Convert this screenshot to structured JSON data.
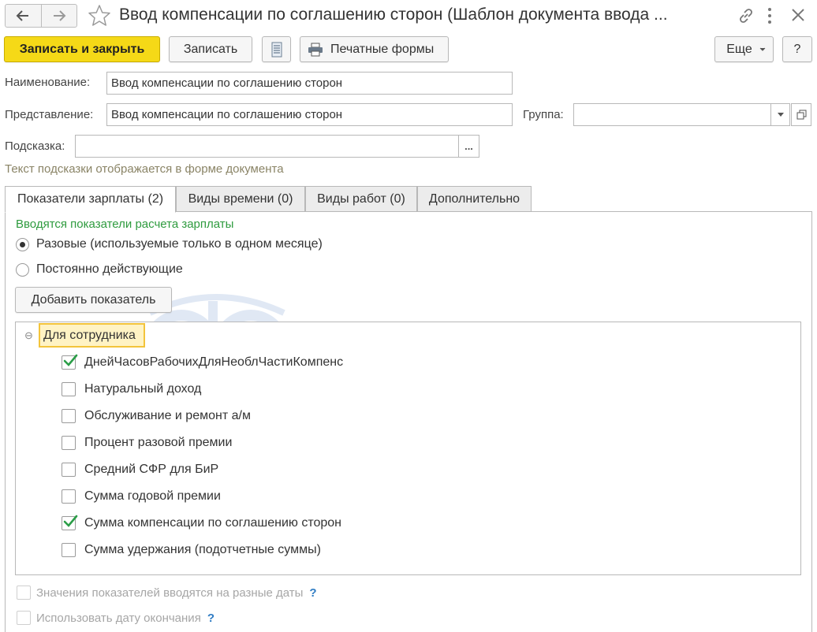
{
  "window": {
    "title": "Ввод компенсации по соглашению сторон (Шаблон документа ввода ..."
  },
  "toolbar": {
    "save_close_label": "Записать и закрыть",
    "save_label": "Записать",
    "print_forms_label": "Печатные формы",
    "more_label": "Еще",
    "help_label": "?"
  },
  "form": {
    "name_label": "Наименование:",
    "name_value": "Ввод компенсации по соглашению сторон",
    "presentation_label": "Представление:",
    "presentation_value": "Ввод компенсации по соглашению сторон",
    "group_label": "Группа:",
    "group_value": "",
    "hint_label": "Подсказка:",
    "hint_value": "",
    "hint_button": "...",
    "hint_note": "Текст подсказки отображается в форме документа"
  },
  "tabs": [
    {
      "label": "Показатели зарплаты (2)",
      "active": true
    },
    {
      "label": "Виды времени (0)",
      "active": false
    },
    {
      "label": "Виды работ (0)",
      "active": false
    },
    {
      "label": "Дополнительно",
      "active": false
    }
  ],
  "indicators": {
    "section_title": "Вводятся показатели расчета зарплаты",
    "radio_options": [
      {
        "label": "Разовые (используемые только в одном месяце)",
        "selected": true
      },
      {
        "label": "Постоянно действующие",
        "selected": false
      }
    ],
    "add_button": "Добавить показатель",
    "group_label": "Для сотрудника",
    "group_toggle": "⊖",
    "items": [
      {
        "label": "ДнейЧасовРабочихДляНеоблЧастиКомпенс",
        "checked": true
      },
      {
        "label": "Натуральный доход",
        "checked": false
      },
      {
        "label": "Обслуживание и ремонт а/м",
        "checked": false
      },
      {
        "label": "Процент разовой премии",
        "checked": false
      },
      {
        "label": "Средний СФР для БиР",
        "checked": false
      },
      {
        "label": "Сумма годовой премии",
        "checked": false
      },
      {
        "label": "Сумма компенсации по соглашению сторон",
        "checked": true
      },
      {
        "label": "Сумма удержания (подотчетные суммы)",
        "checked": false
      }
    ],
    "options": [
      {
        "label": "Значения показателей вводятся на разные даты",
        "help": "?"
      },
      {
        "label": "Использовать дату окончания",
        "help": "?"
      }
    ]
  },
  "watermark": {
    "text": "Бухэксперт"
  },
  "colors": {
    "primary_button": "#f5d917",
    "section_title": "#2e9b3e",
    "checkmark": "#2a9d47",
    "group_highlight_border": "#f3c43b",
    "help_icon": "#2f7cc4"
  }
}
